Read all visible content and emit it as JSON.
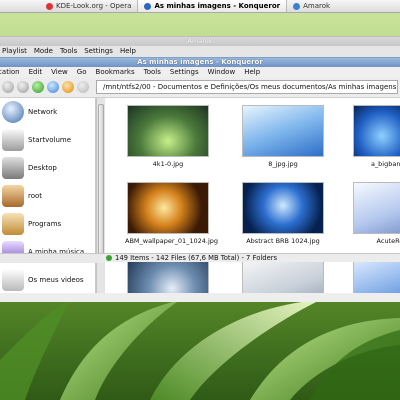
{
  "taskbar": {
    "items": [
      {
        "label": "KDE-Look.org - Opera",
        "icon": "opera-icon",
        "color": "#d33"
      },
      {
        "label": "As minhas imagens - Konqueror",
        "icon": "konqueror-icon",
        "color": "#2a67c4"
      },
      {
        "label": "Amarok",
        "icon": "amarok-icon",
        "color": "#3b7fd0"
      }
    ]
  },
  "amarok": {
    "title": "Amarok",
    "menu": [
      "Playlist",
      "Mode",
      "Tools",
      "Settings",
      "Help"
    ]
  },
  "konqueror": {
    "title": "As minhas imagens - Konqueror",
    "menu": [
      "Location",
      "Edit",
      "View",
      "Go",
      "Bookmarks",
      "Tools",
      "Settings",
      "Window",
      "Help"
    ],
    "location": "/mnt/ntfs2/00 - Documentos e Definições/Os meus documentos/As minhas imagens",
    "sidebar": [
      {
        "label": "Network",
        "icon": "network-icon"
      },
      {
        "label": "Startvolume",
        "icon": "drive-icon"
      },
      {
        "label": "Desktop",
        "icon": "desktop-icon"
      },
      {
        "label": "root",
        "icon": "home-icon"
      },
      {
        "label": "Programs",
        "icon": "programs-icon"
      },
      {
        "label": "A minha música",
        "icon": "music-icon"
      },
      {
        "label": "Os meus videos",
        "icon": "video-icon"
      }
    ],
    "files": [
      {
        "name": "4k1-0.jpg"
      },
      {
        "name": "8_jpg.jpg"
      },
      {
        "name": "a_bigbang_in_"
      },
      {
        "name": "ABM_wallpaper_01_1024.jpg"
      },
      {
        "name": "Abstract BRB 1024.jpg"
      },
      {
        "name": "AcuteRefle"
      },
      {
        "name": ""
      },
      {
        "name": ""
      },
      {
        "name": ""
      }
    ],
    "status": "149 Items - 142 Files (67,6 MB Total) - 7 Folders"
  }
}
